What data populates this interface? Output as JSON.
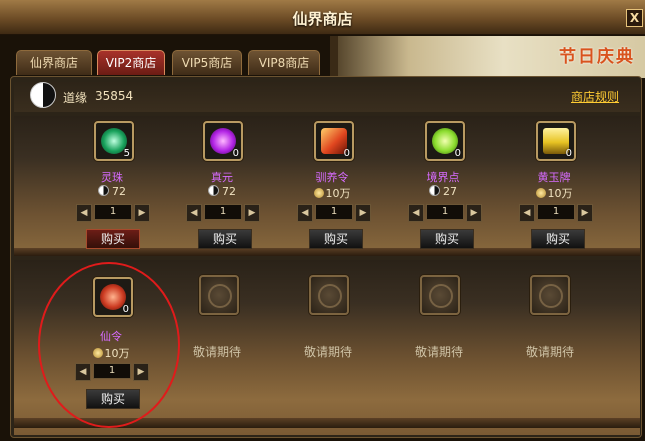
{
  "window": {
    "title": "仙界商店",
    "close_label": "X"
  },
  "banner_text": "节日庆典",
  "tabs": [
    {
      "label": "仙界商店",
      "active": false
    },
    {
      "label": "VIP2商店",
      "active": true
    },
    {
      "label": "VIP5商店",
      "active": false
    },
    {
      "label": "VIP8商店",
      "active": false
    }
  ],
  "currency": {
    "label": "道缘",
    "value": "35854"
  },
  "rules_link": "商店规则",
  "items": [
    {
      "name": "灵珠",
      "count": "5",
      "price": "72",
      "currency_icon": "taiji-icon",
      "qty": "1",
      "buy": "购买",
      "icon": "green-orb-icon",
      "color": "#2bd17a"
    },
    {
      "name": "真元",
      "count": "0",
      "price": "72",
      "currency_icon": "taiji-icon",
      "qty": "1",
      "buy": "购买",
      "icon": "purple-energy-icon",
      "color": "#c24bff"
    },
    {
      "name": "驯养令",
      "count": "0",
      "price": "10万",
      "currency_icon": "coin-icon",
      "qty": "1",
      "buy": "购买",
      "icon": "red-token-icon",
      "color": "#e0461f"
    },
    {
      "name": "境界点",
      "count": "0",
      "price": "27",
      "currency_icon": "taiji-icon",
      "qty": "1",
      "buy": "购买",
      "icon": "green-yinyang-icon",
      "color": "#8bdc2e"
    },
    {
      "name": "黄玉牌",
      "count": "0",
      "price": "10万",
      "currency_icon": "coin-icon",
      "qty": "1",
      "buy": "购买",
      "icon": "yellow-tablet-icon",
      "color": "#e7c323"
    },
    {
      "name": "仙令",
      "count": "0",
      "price": "10万",
      "currency_icon": "coin-icon",
      "qty": "1",
      "buy": "购买",
      "icon": "red-seal-icon",
      "color": "#cc3b22"
    }
  ],
  "pending_label": "敬请期待",
  "colors": {
    "accent": "#ffcc33",
    "item_name": "#d76bff",
    "annotation": "#e01b1b"
  }
}
